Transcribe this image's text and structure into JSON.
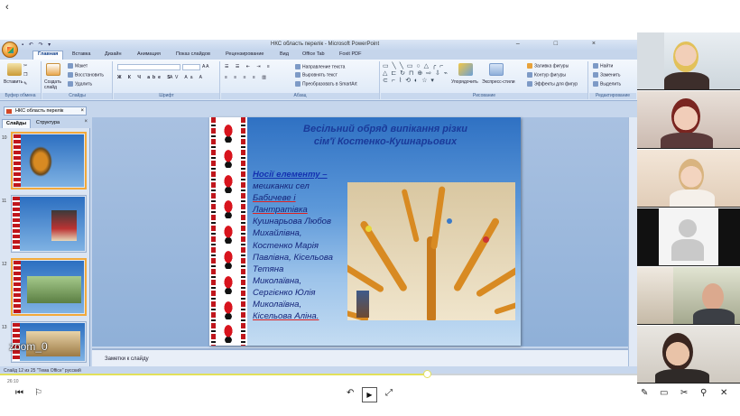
{
  "player": {
    "back_glyph": "‹",
    "zoom_label": "zoom_0",
    "time_text": "26:10",
    "progress": 0.67
  },
  "ppt": {
    "window_title": "НКС область перелік - Microsoft PowerPoint",
    "qat": "▪ ↶ ↷ ▾",
    "win_ctrls": "– □ ×",
    "tabs": [
      "Главная",
      "Вставка",
      "Дизайн",
      "Анимация",
      "Показ слайдов",
      "Рецензирование",
      "Вид",
      "Office Tab",
      "Foxit PDF"
    ],
    "ribbon": {
      "paste": "Вставить",
      "cut": "Вырезать",
      "copy": "Копировать",
      "format_painter": "Формат по образцу",
      "clipboard": "Буфер обмена",
      "new_slide": "Создать слайд",
      "layout": "Макет",
      "reset": "Восстановить",
      "delete": "Удалить",
      "slides_group": "Слайды",
      "font_group": "Шрифт",
      "paragraph_group": "Абзац",
      "text_direction": "Направление текста",
      "align_text": "Выровнять текст",
      "smartart": "Преобразовать в SmartArt",
      "shapes_grid": "▭ ╲ ╲ ▭ ○ △ ╭ ⌐\n△ ⊏ ↻ ⊓ ⊕ ⇨ ⇩ ⌁\n⊂ ⌐ ⌇ ⟲ ◐ ☆ ▾",
      "arrange": "Упорядочить",
      "quick_styles": "Экспресс-стили",
      "drawing_group": "Рисование",
      "shape_fill": "Заливка фигуры",
      "shape_outline": "Контур фигуры",
      "shape_effects": "Эффекты для фигур",
      "find": "Найти",
      "replace": "Заменить",
      "select": "Выделить",
      "editing_group": "Редактирование"
    },
    "doc_tab": "НКС область перелік",
    "pane_tabs": {
      "slides": "Слайды",
      "outline": "Структура"
    },
    "thumbnails": [
      {
        "num": "10",
        "selected": true
      },
      {
        "num": "11",
        "selected": false
      },
      {
        "num": "12",
        "selected": true
      },
      {
        "num": "13",
        "selected": false
      }
    ],
    "slide": {
      "title_line1": "Весільний обряд випікання різки",
      "title_line2": "сім'ї Костенко-Кушнарьових",
      "body_intro": "Носії елементу –",
      "body_lines": [
        "мешканки сел",
        "Бабичеве і",
        "Лантратівка",
        "Кушнарьова Любов",
        "Михайлівна,",
        "Костенко Марія",
        "Павлівна, Кісельова",
        "Тетяна",
        "Миколаївна,",
        "Сергієнко Юлія",
        "Миколаївна,",
        "Кісельова Аліна."
      ]
    },
    "notes_placeholder": "Заметки к слайду",
    "status_text": "Слайд 12 из 25   \"Тема Office\"   русский"
  },
  "player_controls": {
    "skip_back": "⏮",
    "flag": "⚐",
    "prev": "↶",
    "play": "▶",
    "expand": "⤢",
    "pen": "✎",
    "chart": "▭",
    "tools": "✂",
    "zoom": "⚲"
  }
}
